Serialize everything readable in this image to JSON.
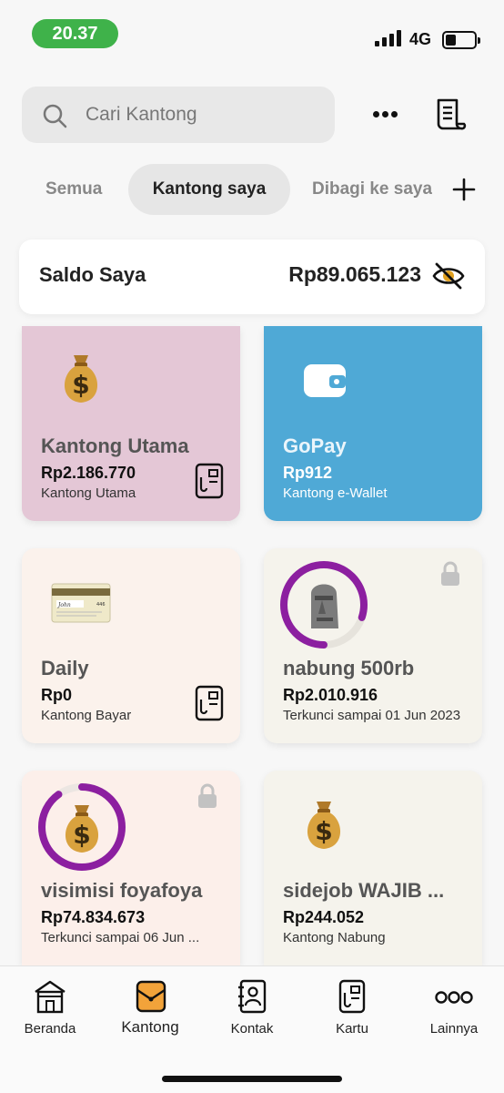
{
  "status_bar": {
    "time": "20.37",
    "network": "4G"
  },
  "search": {
    "placeholder": "Cari Kantong"
  },
  "tabs": [
    {
      "label": "Semua"
    },
    {
      "label": "Kantong saya"
    },
    {
      "label": "Dibagi ke saya"
    }
  ],
  "balance": {
    "label": "Saldo Saya",
    "amount": "Rp89.065.123"
  },
  "pockets": [
    {
      "title": "Kantong Utama",
      "amount": "Rp2.186.770",
      "subtitle": "Kantong Utama",
      "color": "#e4c7d6",
      "icon": "money-bag-icon"
    },
    {
      "title": "GoPay",
      "amount": "Rp912",
      "subtitle": "Kantong e-Wallet",
      "color": "#4fa9d6",
      "icon": "wallet-icon"
    },
    {
      "title": "Daily",
      "amount": "Rp0",
      "subtitle": "Kantong Bayar",
      "color": "#fbf2ec",
      "icon": "debit-card-icon"
    },
    {
      "title": "nabung 500rb",
      "amount": "Rp2.010.916",
      "subtitle": "Terkunci sampai 01 Jun 2023",
      "color": "#f5f3ec",
      "icon": "moai-icon",
      "progress": 0.8
    },
    {
      "title": "visimisi foyafoya",
      "amount": "Rp74.834.673",
      "subtitle": "Terkunci sampai 06 Jun ...",
      "color": "#fcefea",
      "icon": "money-bag-icon",
      "progress": 0.9
    },
    {
      "title": "sidejob WAJIB ...",
      "amount": "Rp244.052",
      "subtitle": "Kantong Nabung",
      "color": "#f5f3ec",
      "icon": "money-bag-icon"
    }
  ],
  "nav": [
    {
      "label": "Beranda",
      "icon": "home-icon"
    },
    {
      "label": "Kantong",
      "icon": "pocket-icon"
    },
    {
      "label": "Kontak",
      "icon": "contacts-icon"
    },
    {
      "label": "Kartu",
      "icon": "card-icon"
    },
    {
      "label": "Lainnya",
      "icon": "more-icon"
    }
  ],
  "colors": {
    "accent_ring": "#8c1fa0",
    "status_green": "#3fb24a"
  }
}
